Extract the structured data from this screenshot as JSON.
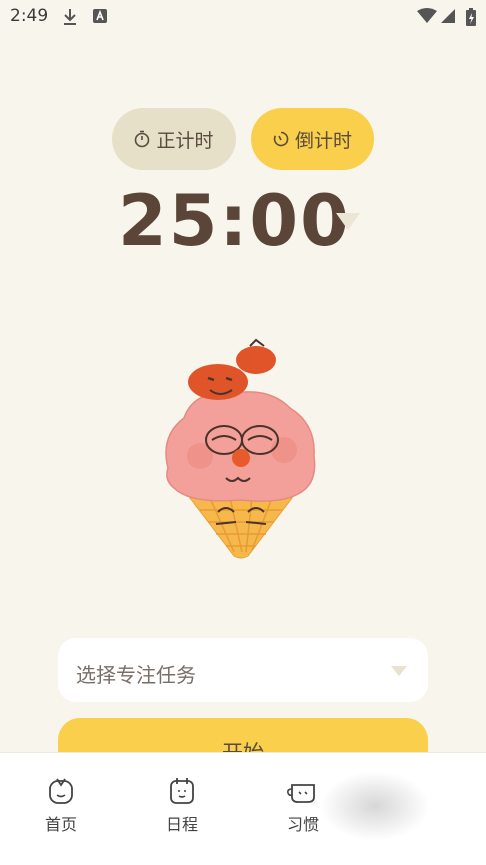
{
  "status_bar": {
    "time": "2:49"
  },
  "mode_tabs": {
    "count_up": "正计时",
    "count_down": "倒计时"
  },
  "timer": {
    "value": "25:00"
  },
  "task_select": {
    "placeholder": "选择专注任务"
  },
  "start_button": {
    "label": "开始"
  },
  "bottom_nav": {
    "items": [
      {
        "label": "首页"
      },
      {
        "label": "日程"
      },
      {
        "label": "习惯"
      }
    ]
  },
  "colors": {
    "background": "#f8f5ec",
    "accent": "#f9cf4b",
    "inactive_tab": "#e6e0c8",
    "text": "#5b4438"
  }
}
